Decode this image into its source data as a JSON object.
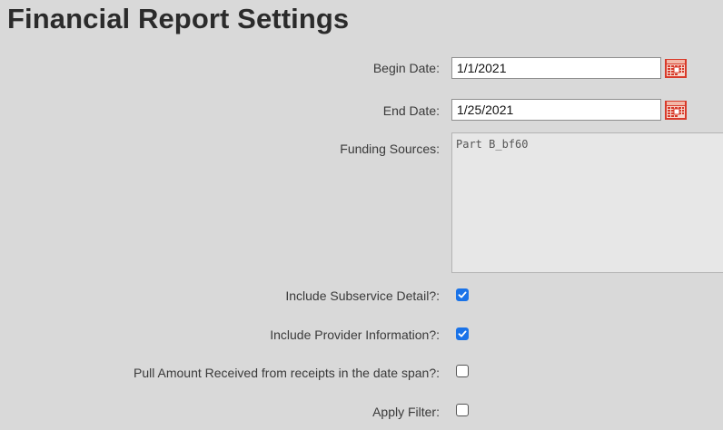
{
  "page": {
    "title": "Financial Report Settings"
  },
  "form": {
    "begin_date": {
      "label": "Begin Date:",
      "value": "1/1/2021",
      "icon": "calendar-icon"
    },
    "end_date": {
      "label": "End Date:",
      "value": "1/25/2021",
      "icon": "calendar-icon"
    },
    "funding_sources": {
      "label": "Funding Sources:",
      "options": [
        "Part B_bf60"
      ]
    },
    "include_subservice_detail": {
      "label": "Include Subservice Detail?:",
      "checked": true
    },
    "include_provider_information": {
      "label": "Include Provider Information?:",
      "checked": true
    },
    "pull_amount_received": {
      "label": "Pull Amount Received from receipts in the date span?:",
      "checked": false
    },
    "apply_filter": {
      "label": "Apply Filter:",
      "checked": false
    }
  },
  "colors": {
    "background": "#d9d9d9",
    "checkbox_checked": "#1a73e8",
    "calendar_red": "#d83a2a"
  }
}
